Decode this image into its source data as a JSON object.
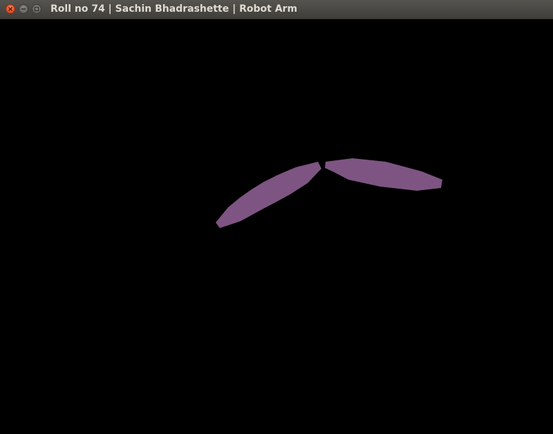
{
  "window": {
    "title": "Roll no 74 | Sachin Bhadrashette | Robot Arm",
    "controls": {
      "close_icon": "close-icon",
      "minimize_icon": "minimize-icon",
      "maximize_icon": "maximize-icon"
    }
  },
  "scene": {
    "background_color": "#000000",
    "arm_color": "#7e5483",
    "segments": [
      {
        "name": "upper-arm"
      },
      {
        "name": "forearm"
      }
    ]
  }
}
